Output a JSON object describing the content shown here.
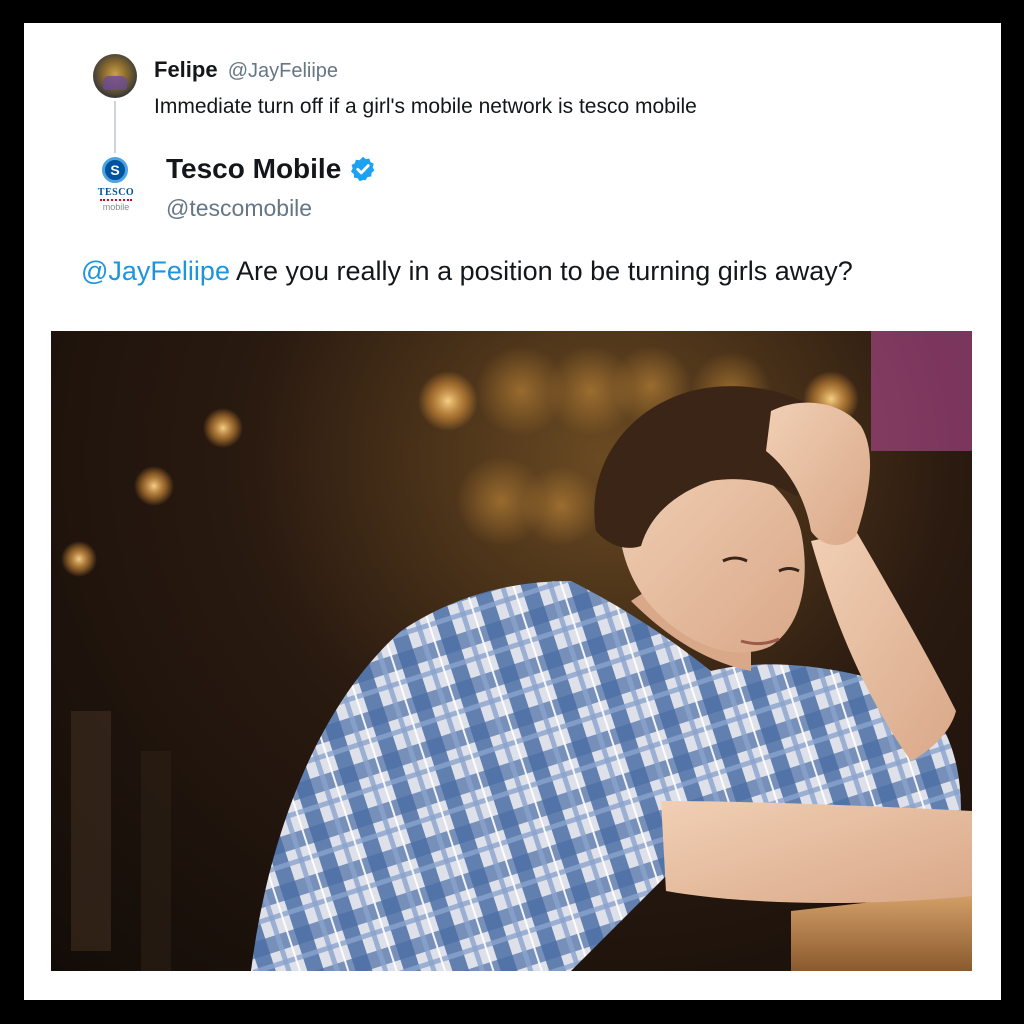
{
  "original_tweet": {
    "name": "Felipe",
    "handle": "@JayFeliipe",
    "text": "Immediate turn off if a girl's mobile network is tesco mobile"
  },
  "reply": {
    "name": "Tesco Mobile",
    "handle": "@tescomobile",
    "verified": true,
    "mention": "@JayFeliipe",
    "text": " Are you really in a position to be turning girls away?",
    "avatar": {
      "logo_text": "TESCO",
      "sub_text": "mobile"
    }
  },
  "photo": {
    "subject": "man-in-plaid-shirt-at-bar",
    "shirt_colors": [
      "#4a6fa5",
      "#e9e6ee",
      "#8fa8cf"
    ]
  },
  "colors": {
    "link": "#1b95e0",
    "verified": "#1da1f2",
    "secondary_text": "#657786",
    "frame": "#000000"
  }
}
